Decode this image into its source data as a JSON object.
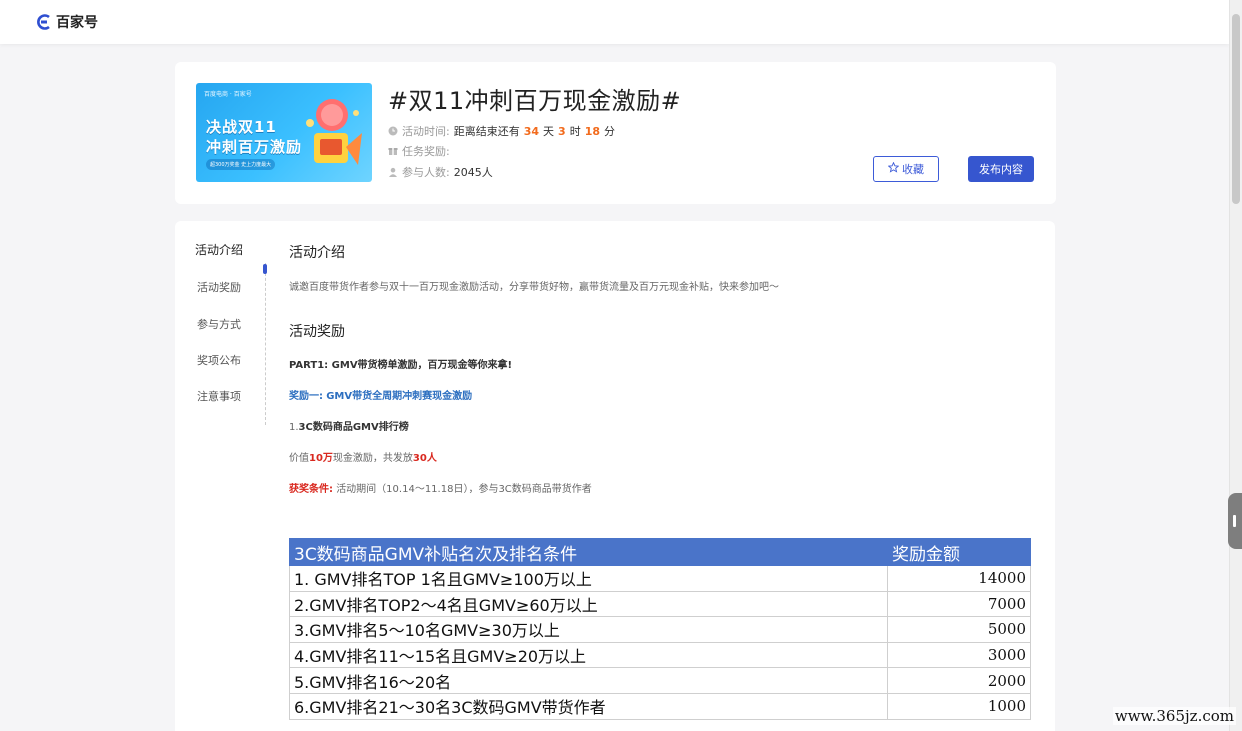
{
  "header": {
    "logo_text": "百家号"
  },
  "activity": {
    "title": "#双11冲刺百万现金激励#",
    "banner": {
      "brand": "百度电商 · 百家号",
      "line1": "决战双11",
      "line2": "冲刺百万激励",
      "sub": "超300万奖金 史上力度最大"
    },
    "time_label": "活动时间:",
    "time_prefix": "距离结束还有",
    "days": "34",
    "days_unit": "天",
    "hours": "3",
    "hours_unit": "时",
    "minutes": "18",
    "minutes_unit": "分",
    "reward_label": "任务奖励:",
    "participants_label": "参与人数:",
    "participants_value": "2045人",
    "collect_button": "收藏",
    "publish_button": "发布内容"
  },
  "nav": {
    "items": [
      {
        "label": "活动介绍"
      },
      {
        "label": "活动奖励"
      },
      {
        "label": "参与方式"
      },
      {
        "label": "奖项公布"
      },
      {
        "label": "注意事项"
      }
    ]
  },
  "content": {
    "intro_heading": "活动介绍",
    "intro_text": "诚邀百度带货作者参与双十一百万现金激励活动，分享带货好物，赢带货流量及百万元现金补贴，快来参加吧～",
    "reward_heading": "活动奖励",
    "part1": "PART1: GMV带货榜单激励，百万现金等你来拿!",
    "reward1_prefix": "奖励一:",
    "reward1_text": "GMV带货全周期冲刺赛现金激励",
    "rank_prefix": "1.",
    "rank_title": "3C数码商品GMV排行榜",
    "value_pre": "价值",
    "value_amount": "10万",
    "value_mid": "现金激励，共发放",
    "value_people": "30人",
    "cond_label": "获奖条件:",
    "cond_text": "活动期间（10.14～11.18日），参与3C数码商品带货作者"
  },
  "table": {
    "headers": [
      "3C数码商品GMV补贴名次及排名条件",
      "奖励金额"
    ],
    "rows": [
      {
        "cond": "1. GMV排名TOP 1名且GMV≥100万以上",
        "amount": "14000"
      },
      {
        "cond": "2.GMV排名TOP2～4名且GMV≥60万以上",
        "amount": "7000"
      },
      {
        "cond": "3.GMV排名5～10名GMV≥30万以上",
        "amount": "5000"
      },
      {
        "cond": "4.GMV排名11～15名且GMV≥20万以上",
        "amount": "3000"
      },
      {
        "cond": "5.GMV排名16～20名",
        "amount": "2000"
      },
      {
        "cond": "6.GMV排名21～30名3C数码GMV带货作者",
        "amount": "1000"
      }
    ]
  },
  "watermark": "www.365jz.com",
  "colors": {
    "primary": "#3656cf",
    "accent_orange": "#f26b1d",
    "link_blue": "#2d6fc0",
    "red": "#d9281f",
    "table_header": "#4a74c9"
  }
}
